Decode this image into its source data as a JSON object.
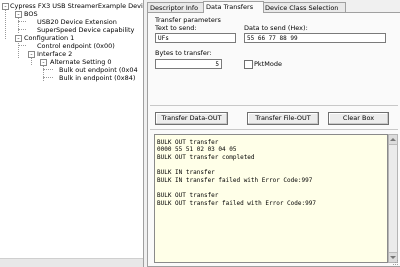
{
  "tree": {
    "nodes": [
      {
        "label": "Cypress FX3 USB StreamerExample Devi",
        "expander": "-"
      },
      {
        "label": "BOS",
        "expander": "-"
      },
      {
        "label": "USB20 Device Extension",
        "expander": ""
      },
      {
        "label": "SuperSpeed Device capability",
        "expander": ""
      },
      {
        "label": "Configuration 1",
        "expander": "-"
      },
      {
        "label": "Control endpoint (0x00)",
        "expander": ""
      },
      {
        "label": "Interface 2",
        "expander": "-"
      },
      {
        "label": "Alternate Setting 0",
        "expander": "-"
      },
      {
        "label": "Bulk out endpoint (0x04",
        "expander": ""
      },
      {
        "label": "Bulk in endpoint (0x84)",
        "expander": ""
      }
    ]
  },
  "tabs": [
    {
      "label": "Descriptor Info"
    },
    {
      "label": "Data Transfers"
    },
    {
      "label": "Device Class Selection"
    }
  ],
  "transfer": {
    "group_label": "Transfer parameters",
    "text_to_send_label": "Text to send:",
    "text_to_send_value": "UFs",
    "data_to_send_label": "Data to send (Hex):",
    "data_to_send_value": "55 66 77 88 99",
    "bytes_label": "Bytes to transfer:",
    "bytes_value": "5",
    "pktmode_label": "PktMode",
    "pktmode_checked": false
  },
  "buttons": {
    "transfer_data_out": "Transfer Data-OUT",
    "transfer_file_out": "Transfer File-OUT",
    "clear_box": "Clear Box"
  },
  "log": {
    "lines": [
      "BULK OUT transfer",
      "0000 55 51 02 03 04 05",
      "BULK OUT transfer completed",
      "",
      "BULK IN transfer",
      "BULK IN transfer failed with Error Code:997",
      "",
      "BULK OUT transfer",
      "BULK OUT transfer failed with Error Code:997"
    ]
  }
}
